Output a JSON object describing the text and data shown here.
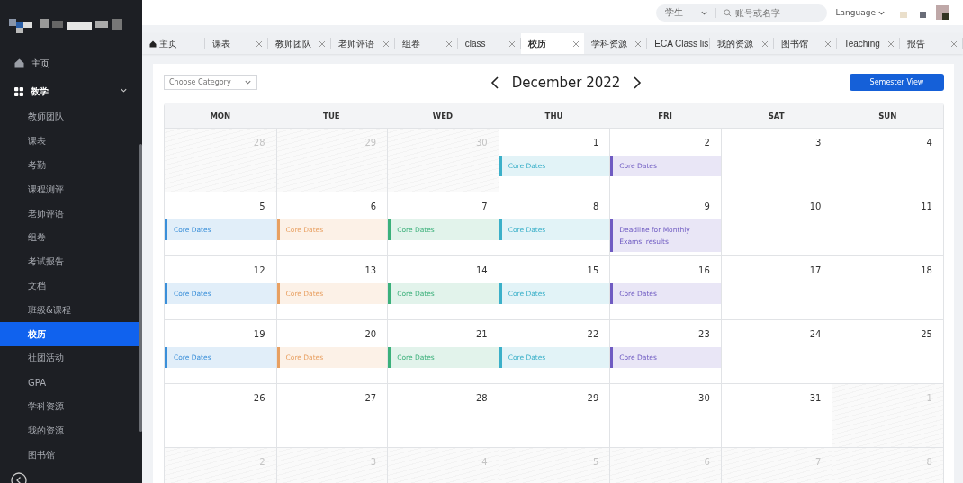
{
  "sidebar": {
    "items": [
      {
        "label": "主页",
        "kind": "home",
        "selected": false
      },
      {
        "label": "教学",
        "kind": "group",
        "selected": false,
        "expanded": true,
        "children": [
          {
            "label": "教师团队",
            "selected": false
          },
          {
            "label": "课表",
            "selected": false
          },
          {
            "label": "考勤",
            "selected": false
          },
          {
            "label": "课程测评",
            "selected": false
          },
          {
            "label": "老师评语",
            "selected": false
          },
          {
            "label": "组卷",
            "selected": false
          },
          {
            "label": "考试报告",
            "selected": false
          },
          {
            "label": "文档",
            "selected": false
          },
          {
            "label": "班级&课程",
            "selected": false
          },
          {
            "label": "校历",
            "selected": true
          },
          {
            "label": "社团活动",
            "selected": false
          },
          {
            "label": "GPA",
            "selected": false
          },
          {
            "label": "学科资源",
            "selected": false
          },
          {
            "label": "我的资源",
            "selected": false
          },
          {
            "label": "图书馆",
            "selected": false
          }
        ]
      }
    ]
  },
  "header": {
    "role": "学生",
    "search": {
      "placeholder": "账号或名字"
    },
    "language": "Language"
  },
  "tabs": [
    {
      "label": "主页",
      "kind": "home",
      "selected": false
    },
    {
      "label": "课表",
      "kind": "page",
      "selected": false
    },
    {
      "label": "教师团队",
      "kind": "page",
      "selected": false
    },
    {
      "label": "老师评语",
      "kind": "page",
      "selected": false
    },
    {
      "label": "组卷",
      "kind": "page",
      "selected": false
    },
    {
      "label": "class",
      "kind": "page",
      "selected": false
    },
    {
      "label": "校历",
      "kind": "page",
      "selected": true
    },
    {
      "label": "学科资源",
      "kind": "page",
      "selected": false
    },
    {
      "label": "ECA Class lis",
      "kind": "page",
      "selected": false
    },
    {
      "label": "我的资源",
      "kind": "page",
      "selected": false
    },
    {
      "label": "图书馆",
      "kind": "page",
      "selected": false
    },
    {
      "label": "Teaching",
      "kind": "page",
      "selected": false
    },
    {
      "label": "报告",
      "kind": "page",
      "selected": false
    }
  ],
  "calendar": {
    "category": {
      "placeholder": "Choose Category"
    },
    "month": "December 2022",
    "view_button": "Semester View",
    "weekdays": [
      "MON",
      "TUE",
      "WED",
      "THU",
      "FRI",
      "SAT",
      "SUN"
    ],
    "weeks": [
      [
        {
          "day": "28",
          "muted": true
        },
        {
          "day": "29",
          "muted": true
        },
        {
          "day": "30",
          "muted": true
        },
        {
          "day": "1",
          "muted": false,
          "events": [
            {
              "title": "Core Dates",
              "color": "#3bb0c9"
            }
          ]
        },
        {
          "day": "2",
          "muted": false,
          "events": [
            {
              "title": "Core Dates",
              "color": "#6f5bc2"
            }
          ]
        },
        {
          "day": "3",
          "muted": false
        },
        {
          "day": "4",
          "muted": false
        }
      ],
      [
        {
          "day": "5",
          "muted": false,
          "events": [
            {
              "title": "Core Dates",
              "color": "#3a8fd9"
            }
          ]
        },
        {
          "day": "6",
          "muted": false,
          "events": [
            {
              "title": "Core Dates",
              "color": "#e8a062"
            }
          ]
        },
        {
          "day": "7",
          "muted": false,
          "events": [
            {
              "title": "Core Dates",
              "color": "#3bb07a"
            }
          ]
        },
        {
          "day": "8",
          "muted": false,
          "events": [
            {
              "title": "Core Dates",
              "color": "#3bb0c9"
            }
          ]
        },
        {
          "day": "9",
          "muted": false,
          "events": [
            {
              "title": "Deadline for Monthly Exams' results",
              "color": "#6f5bc2"
            }
          ]
        },
        {
          "day": "10",
          "muted": false
        },
        {
          "day": "11",
          "muted": false
        }
      ],
      [
        {
          "day": "12",
          "muted": false,
          "events": [
            {
              "title": "Core Dates",
              "color": "#3a8fd9"
            }
          ]
        },
        {
          "day": "13",
          "muted": false,
          "events": [
            {
              "title": "Core Dates",
              "color": "#e8a062"
            }
          ]
        },
        {
          "day": "14",
          "muted": false,
          "events": [
            {
              "title": "Core Dates",
              "color": "#3bb07a"
            }
          ]
        },
        {
          "day": "15",
          "muted": false,
          "events": [
            {
              "title": "Core Dates",
              "color": "#3bb0c9"
            }
          ]
        },
        {
          "day": "16",
          "muted": false,
          "events": [
            {
              "title": "Core Dates",
              "color": "#6f5bc2"
            }
          ]
        },
        {
          "day": "17",
          "muted": false
        },
        {
          "day": "18",
          "muted": false
        }
      ],
      [
        {
          "day": "19",
          "muted": false,
          "events": [
            {
              "title": "Core Dates",
              "color": "#3a8fd9"
            }
          ]
        },
        {
          "day": "20",
          "muted": false,
          "events": [
            {
              "title": "Core Dates",
              "color": "#e8a062"
            }
          ]
        },
        {
          "day": "21",
          "muted": false,
          "events": [
            {
              "title": "Core Dates",
              "color": "#3bb07a"
            }
          ]
        },
        {
          "day": "22",
          "muted": false,
          "events": [
            {
              "title": "Core Dates",
              "color": "#3bb0c9"
            }
          ]
        },
        {
          "day": "23",
          "muted": false,
          "events": [
            {
              "title": "Core Dates",
              "color": "#6f5bc2"
            }
          ]
        },
        {
          "day": "24",
          "muted": false
        },
        {
          "day": "25",
          "muted": false
        }
      ],
      [
        {
          "day": "26",
          "muted": false
        },
        {
          "day": "27",
          "muted": false
        },
        {
          "day": "28",
          "muted": false
        },
        {
          "day": "29",
          "muted": false
        },
        {
          "day": "30",
          "muted": false
        },
        {
          "day": "31",
          "muted": false
        },
        {
          "day": "1",
          "muted": true
        }
      ],
      [
        {
          "day": "2",
          "muted": true
        },
        {
          "day": "3",
          "muted": true
        },
        {
          "day": "4",
          "muted": true
        },
        {
          "day": "5",
          "muted": true
        },
        {
          "day": "6",
          "muted": true
        },
        {
          "day": "7",
          "muted": true
        },
        {
          "day": "8",
          "muted": true
        }
      ]
    ]
  }
}
